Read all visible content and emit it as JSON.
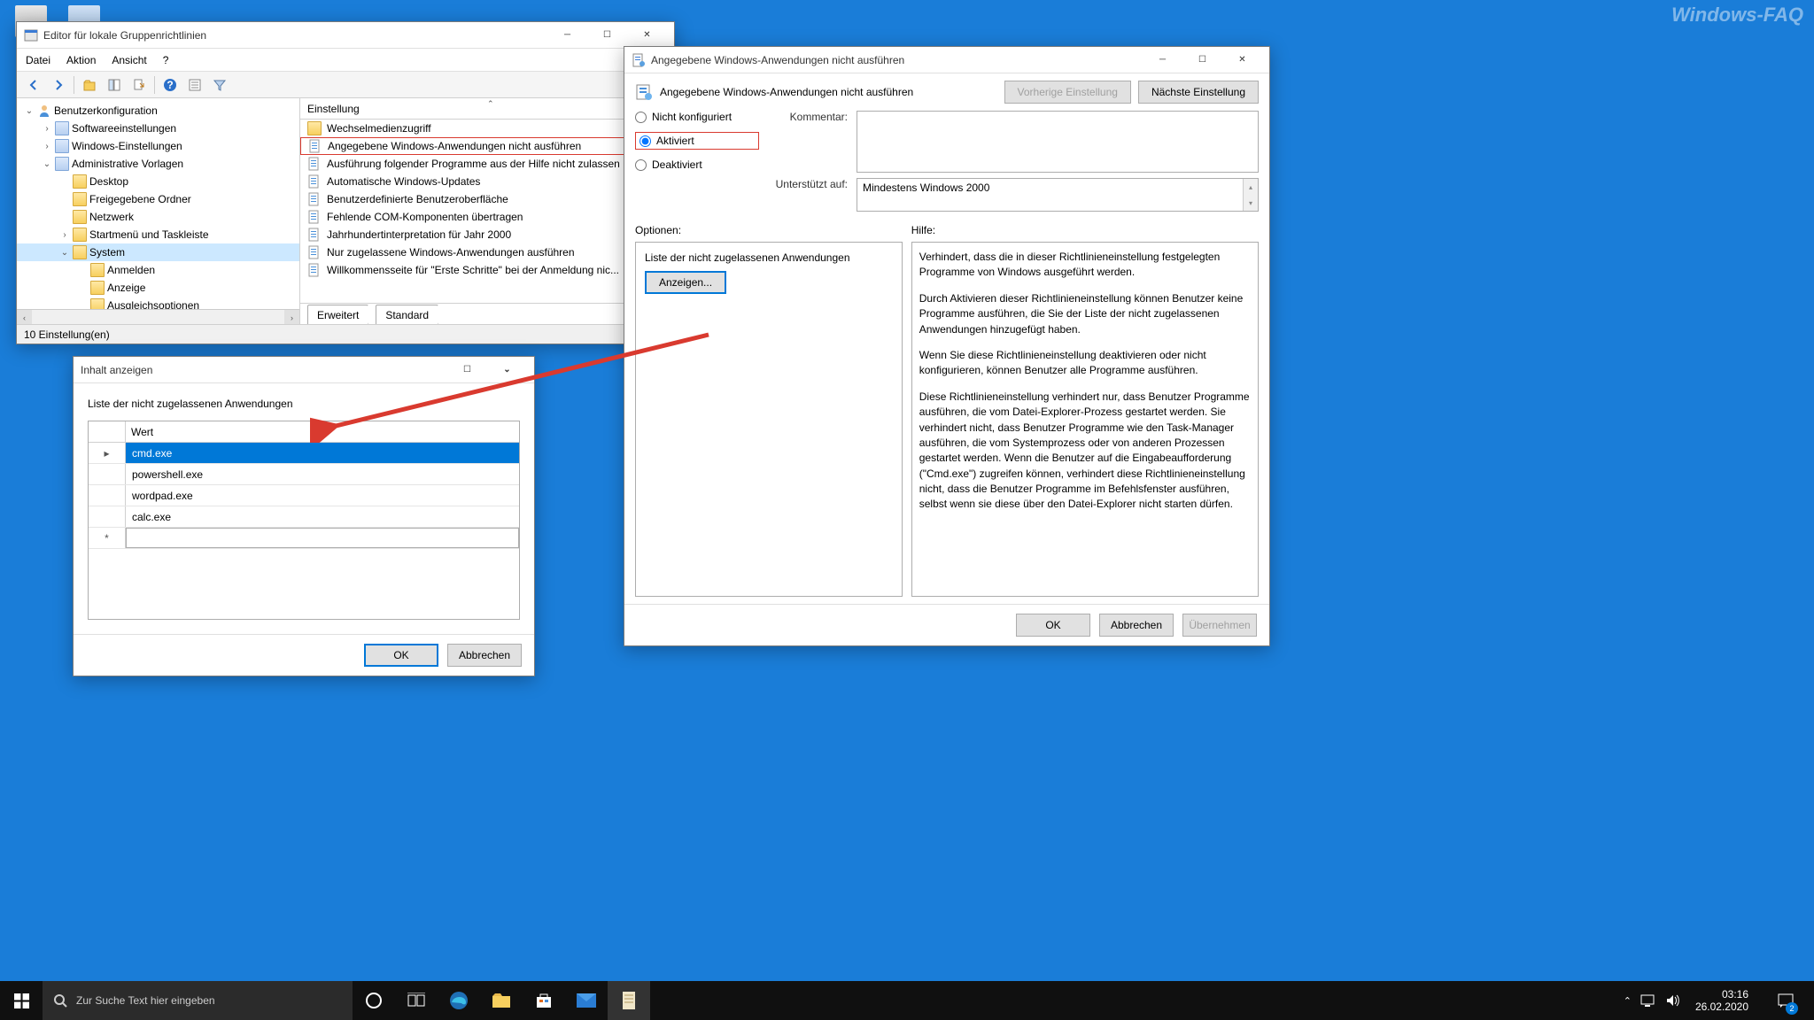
{
  "watermark": "Windows-FAQ",
  "desktop_icons": [
    "",
    ""
  ],
  "gpedit": {
    "title": "Editor für lokale Gruppenrichtlinien",
    "menu": [
      "Datei",
      "Aktion",
      "Ansicht",
      "?"
    ],
    "tree": {
      "root": "Benutzerkonfiguration",
      "items": [
        {
          "indent": 1,
          "caret": ">",
          "icon": "fold",
          "label": "Softwareeinstellungen"
        },
        {
          "indent": 1,
          "caret": ">",
          "icon": "fold",
          "label": "Windows-Einstellungen"
        },
        {
          "indent": 1,
          "caret": "v",
          "icon": "fold",
          "label": "Administrative Vorlagen"
        },
        {
          "indent": 2,
          "caret": "",
          "icon": "fy",
          "label": "Desktop"
        },
        {
          "indent": 2,
          "caret": "",
          "icon": "fy",
          "label": "Freigegebene Ordner"
        },
        {
          "indent": 2,
          "caret": "",
          "icon": "fy",
          "label": "Netzwerk"
        },
        {
          "indent": 2,
          "caret": ">",
          "icon": "fy",
          "label": "Startmenü und Taskleiste"
        },
        {
          "indent": 2,
          "caret": "v",
          "icon": "fy",
          "label": "System",
          "sel": true
        },
        {
          "indent": 3,
          "caret": "",
          "icon": "fy",
          "label": "Anmelden"
        },
        {
          "indent": 3,
          "caret": "",
          "icon": "fy",
          "label": "Anzeige"
        },
        {
          "indent": 3,
          "caret": "",
          "icon": "fy",
          "label": "Ausgleichsoptionen"
        }
      ]
    },
    "list_header": "Einstellung",
    "settings": [
      {
        "icon": "fy",
        "label": "Wechselmedienzugriff"
      },
      {
        "icon": "pol",
        "label": "Angegebene Windows-Anwendungen nicht ausführen",
        "hl": true
      },
      {
        "icon": "pol",
        "label": "Ausführung folgender Programme aus der Hilfe nicht zulassen"
      },
      {
        "icon": "pol",
        "label": "Automatische Windows-Updates"
      },
      {
        "icon": "pol",
        "label": "Benutzerdefinierte Benutzeroberfläche"
      },
      {
        "icon": "pol",
        "label": "Fehlende COM-Komponenten übertragen"
      },
      {
        "icon": "pol",
        "label": "Jahrhundertinterpretation für Jahr 2000"
      },
      {
        "icon": "pol",
        "label": "Nur zugelassene Windows-Anwendungen ausführen"
      },
      {
        "icon": "pol",
        "label": "Willkommensseite für \"Erste Schritte\" bei der Anmeldung nic..."
      }
    ],
    "tabs": [
      "Erweitert",
      "Standard"
    ],
    "status": "10 Einstellung(en)"
  },
  "policy": {
    "title": "Angegebene Windows-Anwendungen nicht ausführen",
    "heading": "Angegebene Windows-Anwendungen nicht ausführen",
    "prev": "Vorherige Einstellung",
    "next": "Nächste Einstellung",
    "radios": {
      "not": "Nicht konfiguriert",
      "on": "Aktiviert",
      "off": "Deaktiviert"
    },
    "comment_lbl": "Kommentar:",
    "supported_lbl": "Unterstützt auf:",
    "supported_val": "Mindestens Windows 2000",
    "options_lbl": "Optionen:",
    "help_lbl": "Hilfe:",
    "list_label": "Liste der nicht zugelassenen Anwendungen",
    "show_btn": "Anzeigen...",
    "help": [
      "Verhindert, dass die in dieser Richtlinieneinstellung festgelegten Programme von Windows ausgeführt werden.",
      "Durch Aktivieren dieser Richtlinieneinstellung können Benutzer keine Programme ausführen, die Sie der Liste der nicht zugelassenen Anwendungen hinzugefügt haben.",
      "Wenn Sie diese Richtlinieneinstellung deaktivieren oder nicht konfigurieren, können Benutzer alle Programme ausführen.",
      "Diese Richtlinieneinstellung verhindert nur, dass Benutzer Programme ausführen, die vom Datei-Explorer-Prozess gestartet werden. Sie verhindert nicht, dass Benutzer Programme wie den Task-Manager ausführen, die vom Systemprozess oder von anderen Prozessen gestartet werden.  Wenn die Benutzer auf die Eingabeaufforderung (\"Cmd.exe\") zugreifen können, verhindert diese Richtlinieneinstellung nicht, dass die Benutzer Programme im Befehlsfenster ausführen, selbst wenn sie diese über den Datei-Explorer nicht starten dürfen."
    ],
    "ok": "OK",
    "cancel": "Abbrechen",
    "apply": "Übernehmen"
  },
  "inhalt": {
    "title": "Inhalt anzeigen",
    "list_label": "Liste der nicht zugelassenen Anwendungen",
    "header": "Wert",
    "rows": [
      "cmd.exe",
      "powershell.exe",
      "wordpad.exe",
      "calc.exe"
    ],
    "ok": "OK",
    "cancel": "Abbrechen"
  },
  "taskbar": {
    "search_placeholder": "Zur Suche Text hier eingeben",
    "time": "03:16",
    "date": "26.02.2020",
    "badge": "2"
  }
}
